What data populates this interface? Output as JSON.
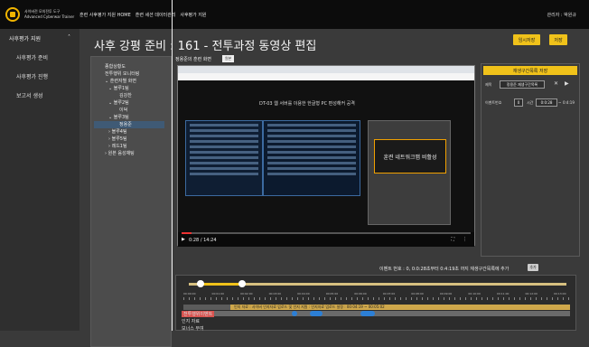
{
  "header": {
    "logo_line1": "사이버전 모의전투 도구",
    "logo_line2": "Advanced Cyberwar Trainer",
    "nav": [
      "훈련 사후평가 지원 HOME",
      "훈련 세션 데이터관리",
      "사후평가 지원"
    ],
    "admin": "관리자 : 박원규"
  },
  "sidebar": {
    "header": "사후평가 지원",
    "items": [
      "사후평가 준비",
      "사후평가 진행",
      "보고서 생성"
    ]
  },
  "page": {
    "title": "사후 강평 준비 : 161 - 전투과정 동영상 편집",
    "btn_temp_save": "임시저장",
    "btn_save": "저장"
  },
  "tree": [
    "종합상황도",
    "전투행위 모니터링",
    "⌄ 훈련자별 화면",
    "⌄ 블루1팀",
    "김강찬",
    "⌄ 블루2팀",
    "이덕",
    "⌄ 블루3팀",
    "정용준",
    "› 블루4팀",
    "› 블루5팀",
    "› 레드1팀",
    "› 원본 음성채팅"
  ],
  "video": {
    "label": "정용준의 훈련 화면",
    "badge": "원본",
    "slide_title": "DT-03 웹 서버를 이용한 한글형 PC 편성해커 공격",
    "slide_box": "훈련 네트워크맵 비활성",
    "time": "0:28 / 14:24",
    "progress": 0.033
  },
  "right_panel": {
    "button": "재생구간목록 저장",
    "title_label": "제목",
    "title_value": "정용준 재생구간목록",
    "event_label": "이벤트번호",
    "event_no": "0",
    "time_label": "시간",
    "time_start": "0:0:28",
    "time_end": "0:4:19"
  },
  "event_bar": {
    "text": "이벤트 번호 : 0, 0:0:28초부터 0:4:19초 까지 재생구간목록에 추가",
    "add_btn": "추가"
  },
  "timeline": {
    "range": [
      0.03,
      0.14
    ],
    "ticks": [
      "00:00:00",
      "00:01:00",
      "00:02:00",
      "00:03:00",
      "00:04:00",
      "00:05:00",
      "00:06:00",
      "00:07:00",
      "00:08:00",
      "00:09:00",
      "00:10:00",
      "00:11:00",
      "00:12:00",
      "00:13:00"
    ],
    "rows": [
      "전투행위이벤트",
      "인지 자료",
      "보너스 부여"
    ],
    "segment_text": "인지 자료 : 사이버 인지자료 업로드 및 인지 지원 : 인지자료 업로드 설정 : 00:04:19 ~ 00:05:02"
  }
}
